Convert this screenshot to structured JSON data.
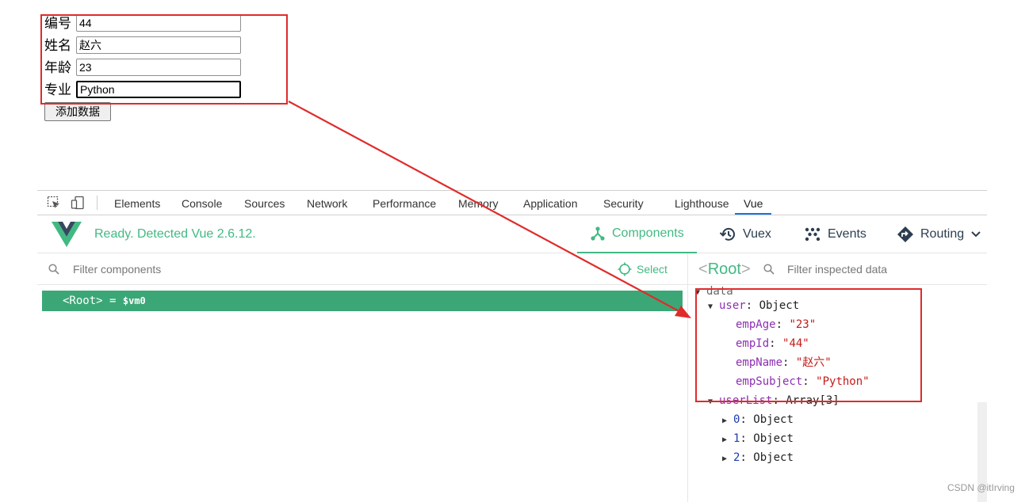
{
  "form": {
    "fields": [
      {
        "label": "编号",
        "value": "44"
      },
      {
        "label": "姓名",
        "value": "赵六"
      },
      {
        "label": "年龄",
        "value": "23"
      },
      {
        "label": "专业",
        "value": "Python"
      }
    ],
    "add_button": "添加数据"
  },
  "devtools": {
    "tabs": [
      "Elements",
      "Console",
      "Sources",
      "Network",
      "Performance",
      "Memory",
      "Application",
      "Security",
      "Lighthouse",
      "Vue"
    ],
    "active_tab": "Vue",
    "vue": {
      "status": "Ready. Detected Vue 2.6.12.",
      "nav": [
        "Components",
        "Vuex",
        "Events",
        "Routing"
      ],
      "active_nav": "Components",
      "filter_components_placeholder": "Filter components",
      "select_label": "Select",
      "root_row": {
        "tag": "<Root>",
        "eq": " = ",
        "vm": "$vm0"
      },
      "inspect": {
        "root_tag": "Root",
        "filter_placeholder": "Filter inspected data",
        "section": "data",
        "user_key": "user",
        "user_type": "Object",
        "user_props": [
          {
            "key": "empAge",
            "value": "\"23\""
          },
          {
            "key": "empId",
            "value": "\"44\""
          },
          {
            "key": "empName",
            "value": "\"赵六\""
          },
          {
            "key": "empSubject",
            "value": "\"Python\""
          }
        ],
        "userlist_key": "userList",
        "userlist_type": "Array[3]",
        "userlist_items": [
          {
            "key": "0",
            "type": "Object"
          },
          {
            "key": "1",
            "type": "Object"
          },
          {
            "key": "2",
            "type": "Object"
          }
        ]
      }
    }
  },
  "colors": {
    "vue_green": "#42b983",
    "annotation_red": "#e02b2b",
    "tab_active": "#1a73e8"
  },
  "watermark": "CSDN @itIrving"
}
